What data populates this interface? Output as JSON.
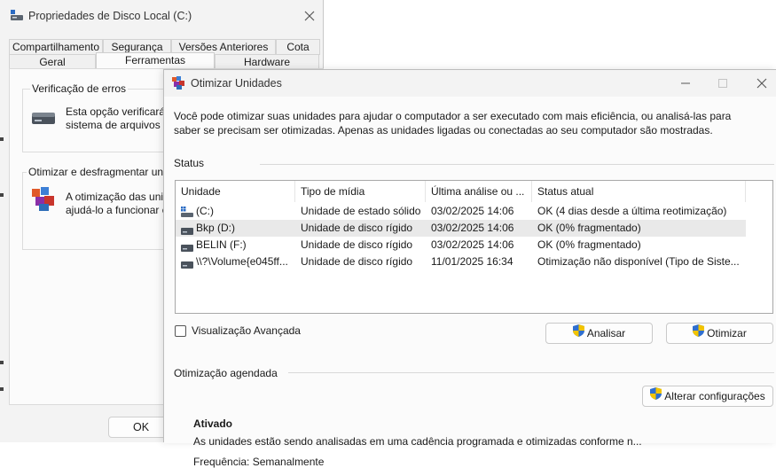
{
  "properties_window": {
    "title": "Propriedades de Disco Local (C:)",
    "tabs_row1": [
      "Compartilhamento",
      "Segurança",
      "Versões Anteriores",
      "Cota"
    ],
    "tabs_row2": [
      "Geral",
      "Ferramentas",
      "Hardware"
    ],
    "active_tab": "Ferramentas",
    "error_check": {
      "title": "Verificação de erros",
      "line1": "Esta opção verificará se",
      "line2": "sistema de arquivos na"
    },
    "defrag": {
      "title": "Otimizar e desfragmentar unidade",
      "line1": "A otimização das unidad",
      "line2": "ajudá-lo a funcionar co"
    },
    "ok_label": "OK"
  },
  "optimize_window": {
    "title": "Otimizar Unidades",
    "intro": "Você pode otimizar suas unidades para ajudar o computador a ser executado com mais eficiência, ou analisá-las para saber se precisam ser otimizadas. Apenas as unidades ligadas ou conectadas ao seu computador são mostradas.",
    "status_label": "Status",
    "columns": [
      "Unidade",
      "Tipo de mídia",
      "Última análise ou ...",
      "Status atual"
    ],
    "drives": [
      {
        "name": "(C:)",
        "media": "Unidade de estado sólido",
        "last": "03/02/2025 14:06",
        "status": "OK (4 dias desde a última reotimização)",
        "icon": "system-drive-icon"
      },
      {
        "name": "Bkp (D:)",
        "media": "Unidade de disco rígido",
        "last": "03/02/2025 14:06",
        "status": "OK (0% fragmentado)",
        "icon": "hard-drive-icon"
      },
      {
        "name": "BELIN (F:)",
        "media": "Unidade de disco rígido",
        "last": "03/02/2025 14:06",
        "status": "OK (0% fragmentado)",
        "icon": "hard-drive-icon"
      },
      {
        "name": "\\\\?\\Volume{e045ff...",
        "media": "Unidade de disco rígido",
        "last": "11/01/2025 16:34",
        "status": "Otimização não disponível (Tipo de Siste...",
        "icon": "hard-drive-icon"
      }
    ],
    "selected_row": 1,
    "advanced_view_label": "Visualização Avançada",
    "advanced_view_checked": false,
    "analyze_label": "Analisar",
    "optimize_label": "Otimizar",
    "scheduled_label": "Otimização agendada",
    "scheduled_state": "Ativado",
    "change_settings_label": "Alterar configurações",
    "scheduled_desc": "As unidades estão sendo analisadas em uma cadência programada e otimizadas conforme n...",
    "frequency": "Frequência: Semanalmente"
  },
  "colors": {
    "window_bg": "#f3f3f3",
    "panel_bg": "#fbfbfb",
    "selection_bg": "#e9e9e9",
    "shield_blue": "#2f6fd0",
    "shield_yellow": "#f2c400"
  }
}
